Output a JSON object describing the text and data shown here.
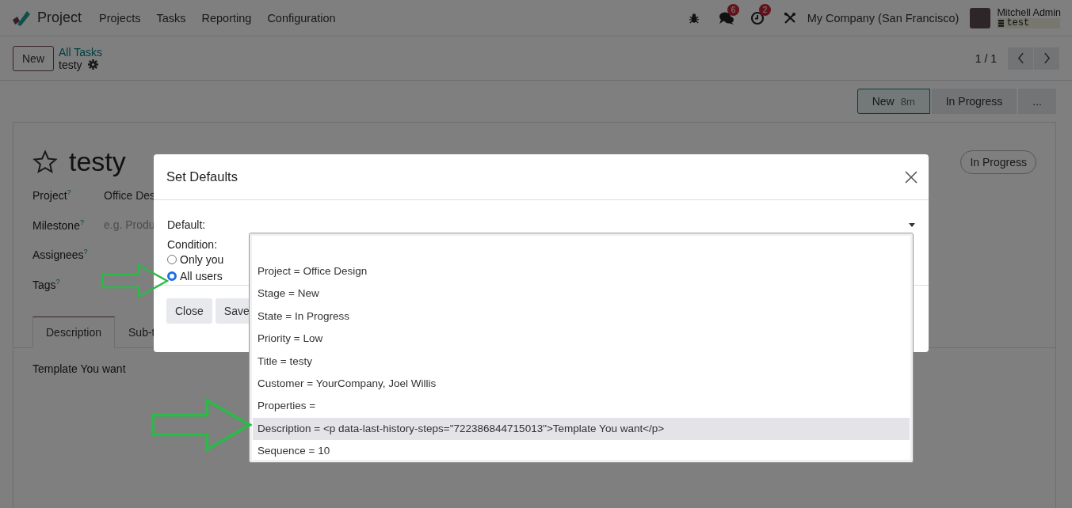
{
  "navbar": {
    "app_name": "Project",
    "menu": [
      "Projects",
      "Tasks",
      "Reporting",
      "Configuration"
    ],
    "chat_badge": "6",
    "activity_badge": "2",
    "company": "My Company (San Francisco)",
    "user_name": "Mitchell Admin",
    "database": "test"
  },
  "control_panel": {
    "new_button": "New",
    "breadcrumb": "All Tasks",
    "record": "testy",
    "pager": "1 / 1"
  },
  "statusbar": [
    {
      "label": "New",
      "duration": "8m",
      "selected": true
    },
    {
      "label": "In Progress",
      "selected": false
    },
    {
      "label": "...",
      "selected": false
    }
  ],
  "form": {
    "title": "testy",
    "starred": false,
    "state_badge": "In Progress",
    "fields": [
      {
        "label": "Project$^{?}$",
        "value": "Office Des"
      },
      {
        "label": "Milestone$^{?}$",
        "placeholder": "e.g. Produ"
      },
      {
        "label": "Assignees$^{?}$"
      },
      {
        "label": "Tags$^{?}$"
      }
    ],
    "tabs": [
      {
        "label": "Description",
        "selected": true
      },
      {
        "label": "Sub-t",
        "selected": false
      }
    ],
    "description": "Template You want"
  },
  "dialog": {
    "title": "Set Defaults",
    "default_label": "Default:",
    "condition_label": "Condition:",
    "options": [
      {
        "label": "Only you",
        "selected": false
      },
      {
        "label": "All users",
        "selected": true
      }
    ],
    "buttons": [
      "Close",
      "Save"
    ]
  },
  "dropdown": {
    "options": [
      {
        "label": "Project = Office Design",
        "selected": false
      },
      {
        "label": "Stage = New",
        "selected": false
      },
      {
        "label": "State = In Progress",
        "selected": false
      },
      {
        "label": "Priority = Low",
        "selected": false
      },
      {
        "label": "Title = testy",
        "selected": false
      },
      {
        "label": "Customer = YourCompany, Joel Willis",
        "selected": false
      },
      {
        "label": "Properties =",
        "selected": false
      },
      {
        "label": "Description = <p data-last-history-steps=\"722386844715013\">Template You want</p>",
        "selected": true
      },
      {
        "label": "Sequence = 10",
        "selected": false
      }
    ]
  }
}
